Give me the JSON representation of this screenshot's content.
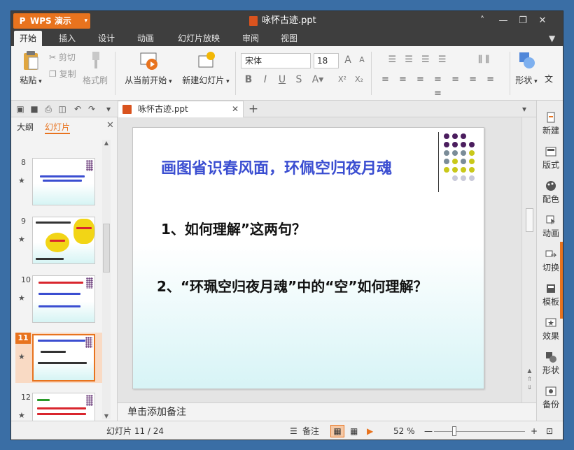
{
  "app": {
    "name": "WPS 演示",
    "doc_title": "咏怀古迹.ppt"
  },
  "window_controls": {
    "up": "˄",
    "minimize": "—",
    "restore": "❐",
    "close": "✕",
    "shirt": "👕"
  },
  "menu": {
    "tabs": [
      "开始",
      "插入",
      "设计",
      "动画",
      "幻灯片放映",
      "审阅",
      "视图"
    ],
    "active": "开始"
  },
  "ribbon": {
    "paste": "粘贴",
    "cut": "剪切",
    "copy": "复制",
    "format_painter": "格式刷",
    "from_current": "从当前开始",
    "new_slide": "新建幻灯片",
    "font": "宋体",
    "size": "18",
    "shape": "形状",
    "text_partial": "文"
  },
  "doc_tab": {
    "label": "咏怀古迹.ppt"
  },
  "panel": {
    "tab_outline": "大纲",
    "tab_slides": "幻灯片"
  },
  "thumbnails": [
    {
      "num": "8"
    },
    {
      "num": "9"
    },
    {
      "num": "10"
    },
    {
      "num": "11"
    },
    {
      "num": "12"
    }
  ],
  "slide": {
    "title": "画图省识春风面，环佩空归夜月魂",
    "q1": "1、如何理解”这两句？",
    "q2": "2、“环珮空归夜月魂”中的“空”如何理解？"
  },
  "notes": {
    "placeholder": "单击添加备注"
  },
  "right_panel": [
    "新建",
    "版式",
    "配色",
    "动画",
    "切换",
    "模板",
    "效果",
    "形状",
    "备份"
  ],
  "status": {
    "slide_count": "幻灯片 11 / 24",
    "notes": "备注",
    "zoom": "52 %"
  },
  "colors": {
    "accent": "#e8731e",
    "title_blue": "#3b4ed1",
    "dark": "#3e3e3e"
  }
}
